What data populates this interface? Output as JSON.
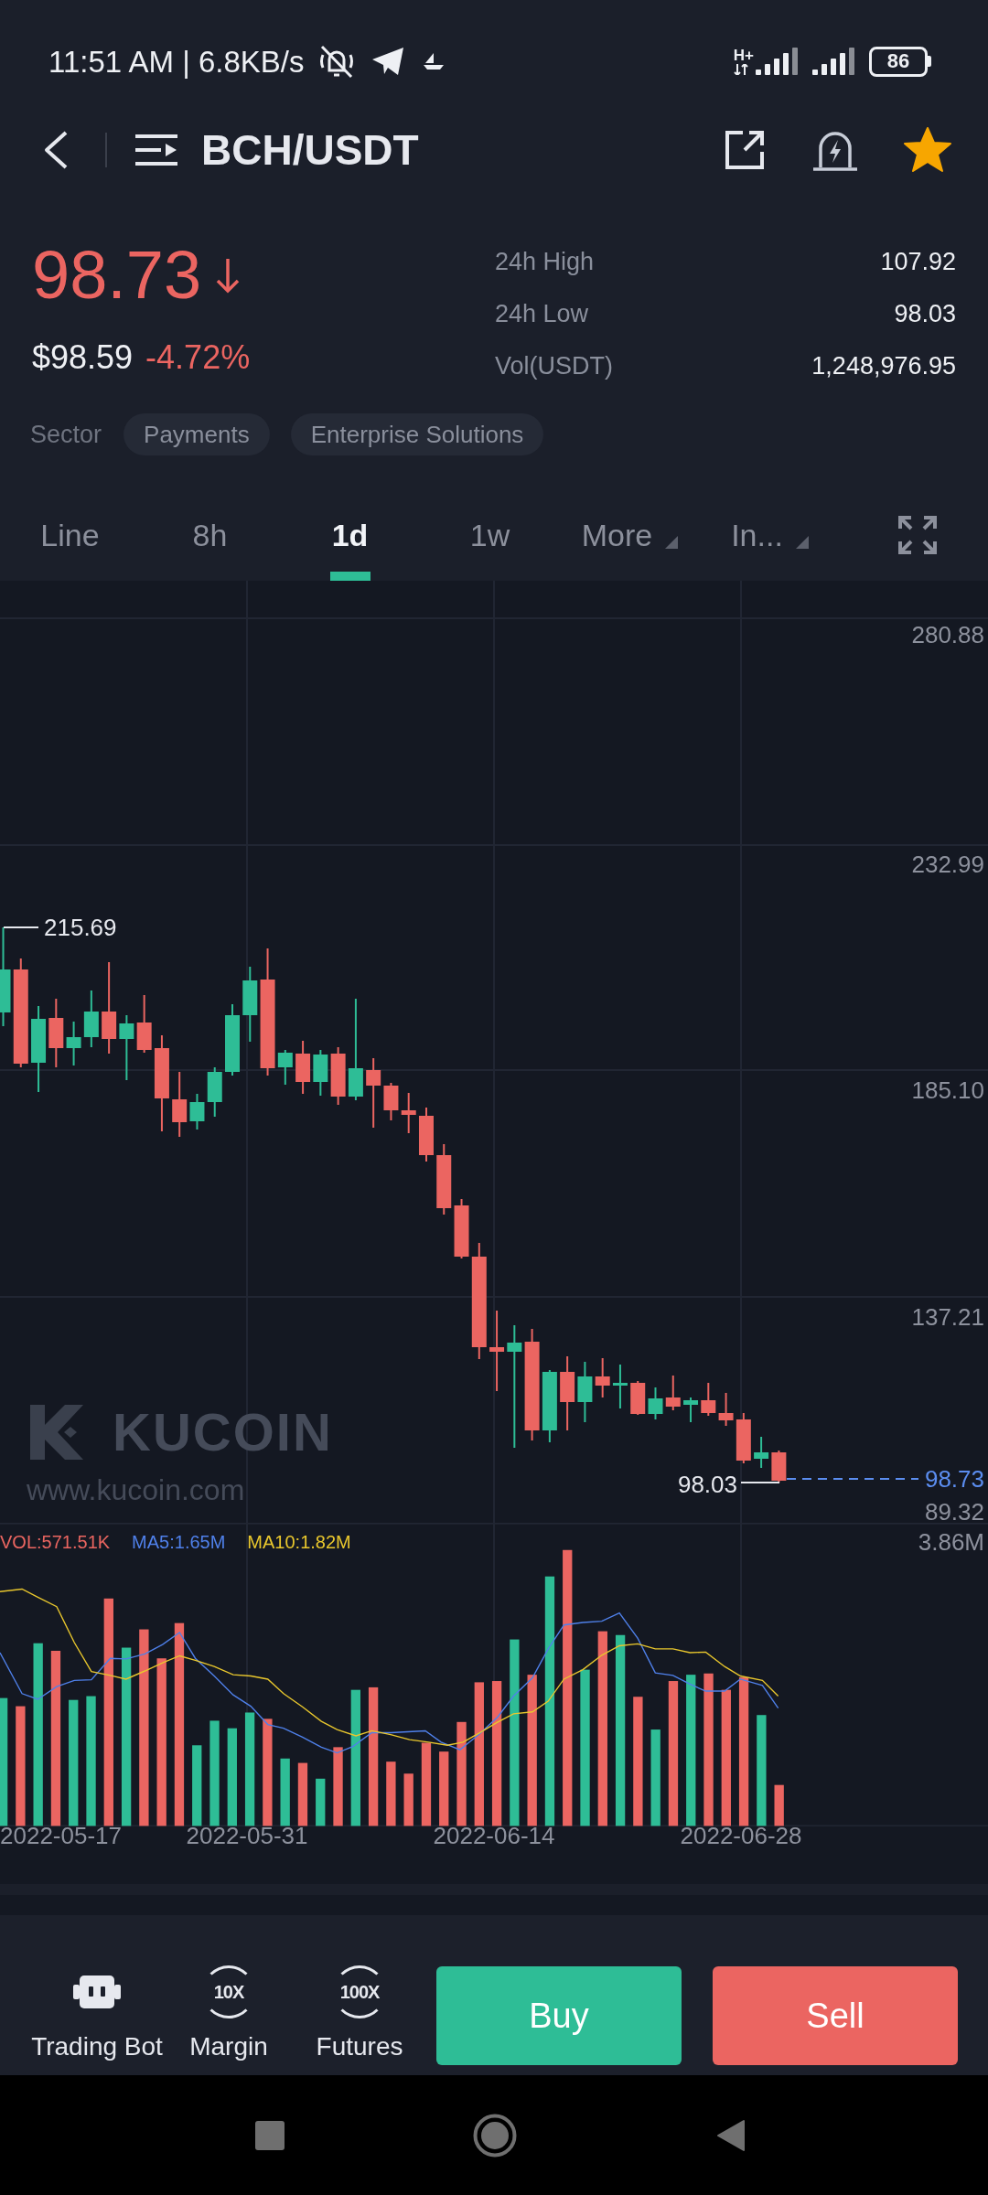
{
  "status_bar": {
    "text": "11:51 AM | 6.8KB/s",
    "network": "H+",
    "battery": "86"
  },
  "header": {
    "pair": "BCH/USDT",
    "favorite": true
  },
  "price": {
    "last": "98.73",
    "falling": true,
    "fiat": "$98.59",
    "change": "-4.72%"
  },
  "stats": [
    {
      "label": "24h High",
      "value": "107.92"
    },
    {
      "label": "24h Low",
      "value": "98.03"
    },
    {
      "label": "Vol(USDT)",
      "value": "1,248,976.95"
    }
  ],
  "sector": {
    "label": "Sector",
    "tags": [
      "Payments",
      "Enterprise Solutions"
    ]
  },
  "tabs": [
    {
      "label": "Line",
      "kind": "plain",
      "selected": false
    },
    {
      "label": "8h",
      "kind": "plain",
      "selected": false
    },
    {
      "label": "1d",
      "kind": "plain",
      "selected": true
    },
    {
      "label": "1w",
      "kind": "plain",
      "selected": false
    },
    {
      "label": "More",
      "kind": "dropdown",
      "selected": false
    },
    {
      "label": "In...",
      "kind": "dropdown",
      "selected": false
    }
  ],
  "chart": {
    "y_labels": [
      "280.88",
      "232.99",
      "185.10",
      "137.21",
      "89.32"
    ],
    "high_marker": "215.69",
    "low_marker": "98.03",
    "last_price": "98.73",
    "watermark": {
      "brand": "KUCOIN",
      "url": "www.kucoin.com"
    }
  },
  "volume": {
    "legend": [
      {
        "label": "VOL:571.51K",
        "color": "#ea6560"
      },
      {
        "label": "MA5:1.65M",
        "color": "#4f80ea"
      },
      {
        "label": "MA10:1.82M",
        "color": "#e9c72d"
      }
    ],
    "max_label": "3.86M"
  },
  "x_labels": [
    "2022-05-17",
    "2022-05-31",
    "2022-06-14",
    "2022-06-28"
  ],
  "tools": [
    {
      "label": "Trading Bot",
      "kind": "bot"
    },
    {
      "label": "Margin",
      "kind": "leverage",
      "badge": "10X"
    },
    {
      "label": "Futures",
      "kind": "leverage",
      "badge": "100X"
    }
  ],
  "actions": [
    {
      "label": "Buy",
      "kind": "buy"
    },
    {
      "label": "Sell",
      "kind": "sell"
    }
  ]
}
